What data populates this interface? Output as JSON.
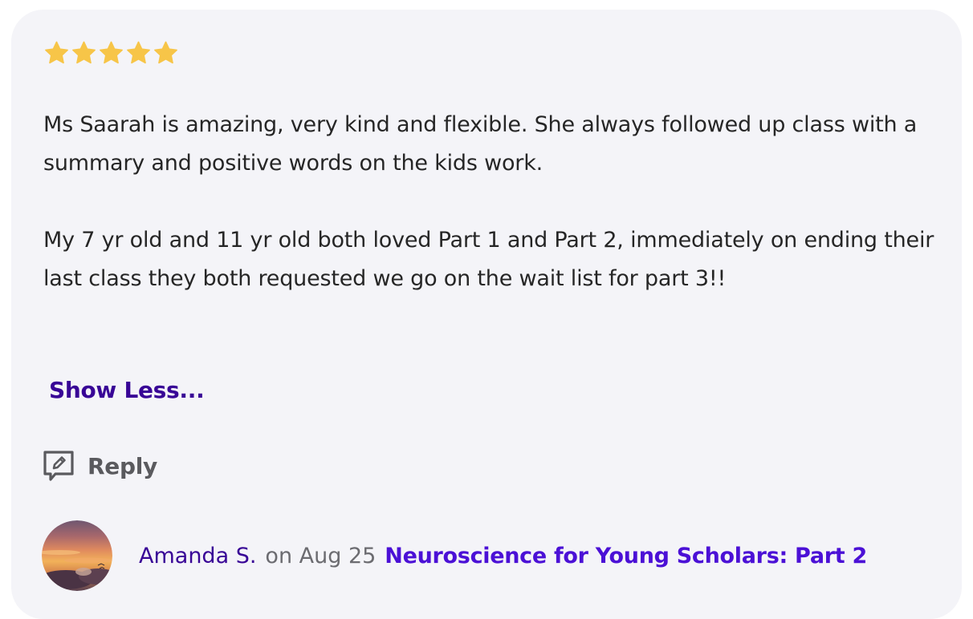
{
  "review": {
    "rating": 5,
    "rating_max": 5,
    "star_color": "#f7c548",
    "paragraphs": [
      "Ms Saarah is amazing, very kind and flexible.  She always followed up class with a summary and positive words on the kids work.",
      "My 7 yr old and 11 yr old both loved Part 1 and Part 2, immediately on ending their last class they both requested we go on the wait list for part 3!!"
    ],
    "show_less_label": "Show Less...",
    "reply_label": "Reply",
    "reply_icon": "edit-comment-icon"
  },
  "author": {
    "name": "Amanda S.",
    "date_text": "on Aug 25",
    "class_title": "Neuroscience for Young Scholars: Part 2",
    "avatar": "sunset-avatar"
  },
  "colors": {
    "card_background": "#f4f4f8",
    "text": "#262626",
    "link_dark": "#380596",
    "link_bright": "#4b10d6",
    "muted": "#6b6b70"
  }
}
